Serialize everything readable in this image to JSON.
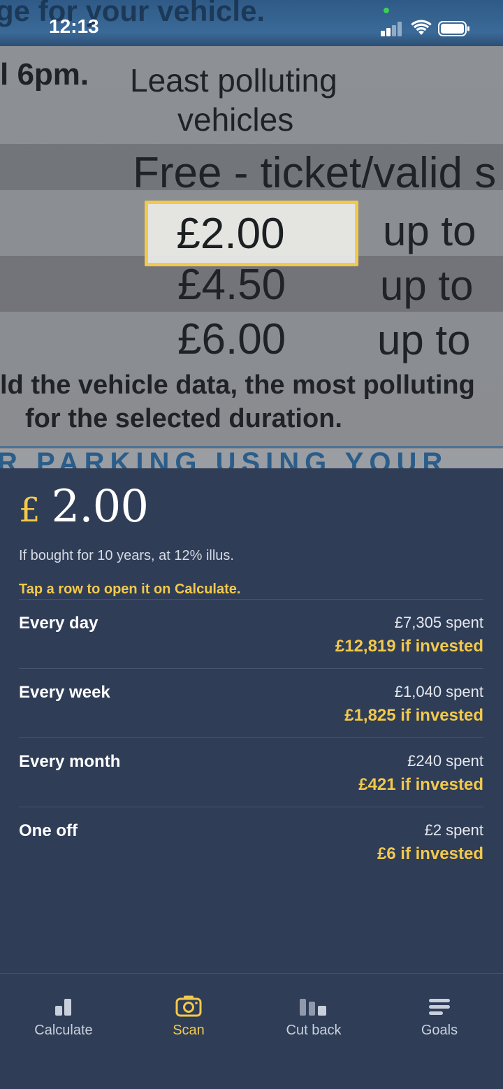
{
  "status_bar": {
    "time": "12:13"
  },
  "camera": {
    "lines": [
      "ge for your vehicle.",
      "l 6pm.",
      "Least polluting",
      "vehicles",
      "Free - ticket/valid s",
      "£4.50",
      "£6.00",
      "up to",
      "up to",
      "up to",
      "ld the vehicle data, the most polluting",
      "for the selected duration.",
      "R PARKING USING YOUR"
    ],
    "detected_price": "£2.00"
  },
  "result": {
    "currency_symbol": "£",
    "amount": "2.00",
    "subtitle": "If bought for 10 years, at 12% illus.",
    "hint": "Tap a row to open it on Calculate.",
    "rows": [
      {
        "label": "Every day",
        "spent": "£7,305 spent",
        "invested": "£12,819 if invested"
      },
      {
        "label": "Every week",
        "spent": "£1,040 spent",
        "invested": "£1,825 if invested"
      },
      {
        "label": "Every month",
        "spent": "£240 spent",
        "invested": "£421 if invested"
      },
      {
        "label": "One off",
        "spent": "£2 spent",
        "invested": "£6 if invested"
      }
    ]
  },
  "tabs": [
    {
      "label": "Calculate",
      "icon": "bar-chart-icon",
      "active": false
    },
    {
      "label": "Scan",
      "icon": "camera-icon",
      "active": true
    },
    {
      "label": "Cut back",
      "icon": "cut-back-chart-icon",
      "active": false
    },
    {
      "label": "Goals",
      "icon": "list-lines-icon",
      "active": false
    }
  ],
  "colors": {
    "accent": "#f2c94c",
    "panel_bg": "#2f3d57",
    "text": "#ffffff"
  }
}
